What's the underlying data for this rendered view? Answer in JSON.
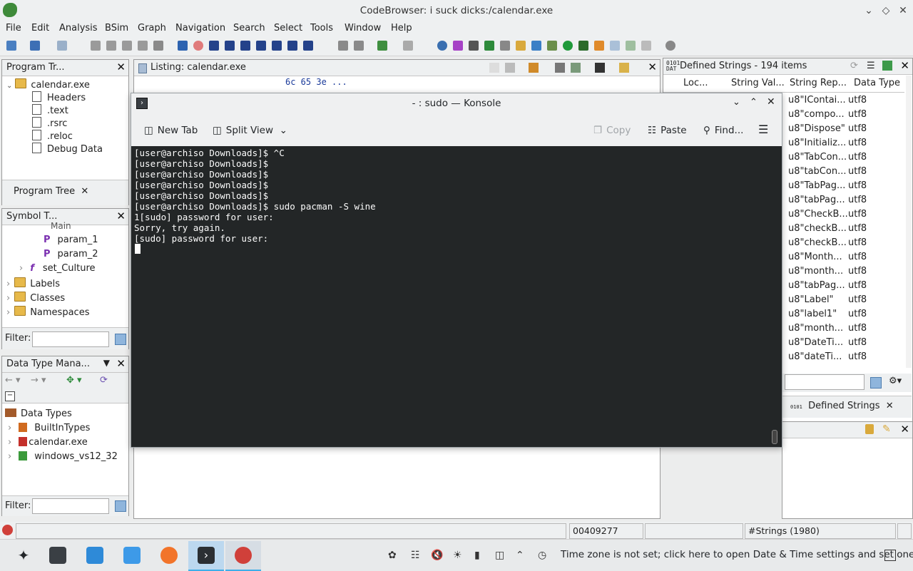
{
  "window": {
    "title": "CodeBrowser: i suck dicks:/calendar.exe"
  },
  "menu": [
    "File",
    "Edit",
    "Analysis",
    "BSim",
    "Graph",
    "Navigation",
    "Search",
    "Select",
    "Tools",
    "Window",
    "Help"
  ],
  "program_tree": {
    "header": "Program Tr...",
    "root": "calendar.exe",
    "items": [
      "Headers",
      ".text",
      ".rsrc",
      ".reloc",
      "Debug Data"
    ],
    "tab": "Program Tree"
  },
  "symbol_tree": {
    "header": "Symbol T...",
    "partial_top": "Main",
    "items": [
      {
        "label": "param_1"
      },
      {
        "label": "param_2"
      },
      {
        "label": "set_Culture"
      },
      {
        "label": "Labels"
      },
      {
        "label": "Classes"
      },
      {
        "label": "Namespaces"
      }
    ],
    "filter_label": "Filter:"
  },
  "data_type_manager": {
    "header": "Data Type Mana...",
    "root": "Data Types",
    "items": [
      "BuiltInTypes",
      "calendar.exe",
      "windows_vs12_32"
    ],
    "filter_label": "Filter:"
  },
  "listing": {
    "header": "Listing:  calendar.exe",
    "hex_line": "6c 65 3e  ..."
  },
  "defined_strings": {
    "header": "Defined Strings - 194 items",
    "columns": [
      "Loc...",
      "String Val...",
      "String Rep...",
      "Data Type"
    ],
    "rows": [
      {
        "rep": "u8\"IContai...",
        "type": "utf8"
      },
      {
        "rep": "u8\"compo...",
        "type": "utf8"
      },
      {
        "rep": "u8\"Dispose\"",
        "type": "utf8"
      },
      {
        "rep": "u8\"Initializ...",
        "type": "utf8"
      },
      {
        "rep": "u8\"TabCon...",
        "type": "utf8"
      },
      {
        "rep": "u8\"tabCon...",
        "type": "utf8"
      },
      {
        "rep": "u8\"TabPag...",
        "type": "utf8"
      },
      {
        "rep": "u8\"tabPag...",
        "type": "utf8"
      },
      {
        "rep": "u8\"CheckB...",
        "type": "utf8"
      },
      {
        "rep": "u8\"checkB...",
        "type": "utf8"
      },
      {
        "rep": "u8\"checkB...",
        "type": "utf8"
      },
      {
        "rep": "u8\"Month...",
        "type": "utf8"
      },
      {
        "rep": "u8\"month...",
        "type": "utf8"
      },
      {
        "rep": "u8\"tabPag...",
        "type": "utf8"
      },
      {
        "rep": "u8\"Label\"",
        "type": "utf8"
      },
      {
        "rep": "u8\"label1\"",
        "type": "utf8"
      },
      {
        "rep": "u8\"month...",
        "type": "utf8"
      },
      {
        "rep": "u8\"DateTi...",
        "type": "utf8"
      },
      {
        "rep": "u8\"dateTi...",
        "type": "utf8"
      }
    ],
    "tab": "Defined Strings"
  },
  "konsole": {
    "title": "- : sudo — Konsole",
    "toolbar": {
      "new_tab": "New Tab",
      "split_view": "Split View",
      "copy": "Copy",
      "paste": "Paste",
      "find": "Find..."
    },
    "lines": [
      "[user@archiso Downloads]$ ^C",
      "[user@archiso Downloads]$",
      "[user@archiso Downloads]$",
      "[user@archiso Downloads]$",
      "[user@archiso Downloads]$",
      "[user@archiso Downloads]$ sudo pacman -S wine",
      "1[sudo] password for user:",
      "Sorry, try again.",
      "[sudo] password for user:"
    ]
  },
  "status": {
    "address": "00409277",
    "strings": "#Strings  (1980)"
  },
  "taskbar": {
    "clock_text": "Time zone is not set; click here to open Date & Time settings and set one"
  }
}
